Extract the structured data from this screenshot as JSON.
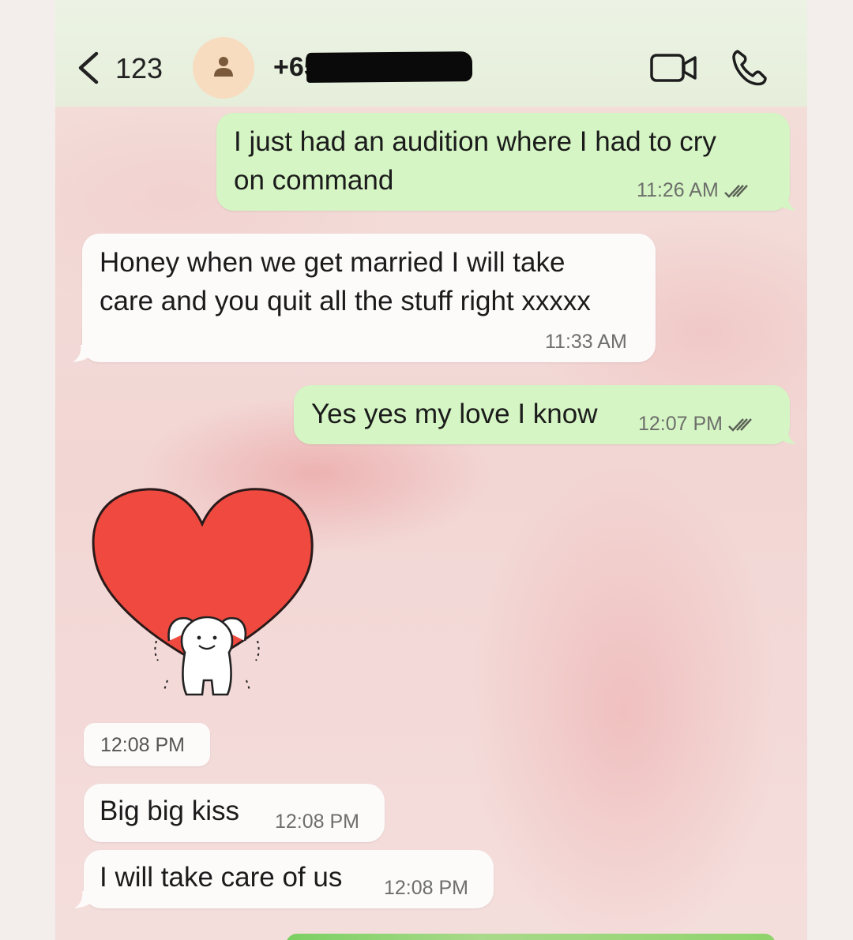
{
  "header": {
    "back_count": "123",
    "contact_name": "+65",
    "icons": {
      "back": "chevron-left-icon",
      "avatar": "person-icon",
      "video": "video-camera-icon",
      "call": "phone-icon"
    }
  },
  "messages": [
    {
      "direction": "outgoing",
      "text_line1": "I just had an audition where I had to cry",
      "text_line2": "on command",
      "time": "11:26 AM",
      "status": "read"
    },
    {
      "direction": "incoming",
      "text_line1": "Honey when we get married I will take",
      "text_line2": "care and you quit all the stuff right xxxxx",
      "time": "11:33 AM"
    },
    {
      "direction": "outgoing",
      "text": "Yes yes my love I know",
      "time": "12:07 PM",
      "status": "read"
    },
    {
      "direction": "incoming",
      "type": "sticker",
      "sticker": "heart-sticker",
      "time": "12:08 PM"
    },
    {
      "direction": "incoming",
      "text": "Big big kiss",
      "time": "12:08 PM"
    },
    {
      "direction": "incoming",
      "text": "I will take care of us",
      "time": "12:08 PM"
    }
  ],
  "colors": {
    "outgoing_bubble": "#d5f5c4",
    "incoming_bubble": "#fdfafa",
    "header_bg": "#e6eedb",
    "heart": "#f0493f"
  }
}
